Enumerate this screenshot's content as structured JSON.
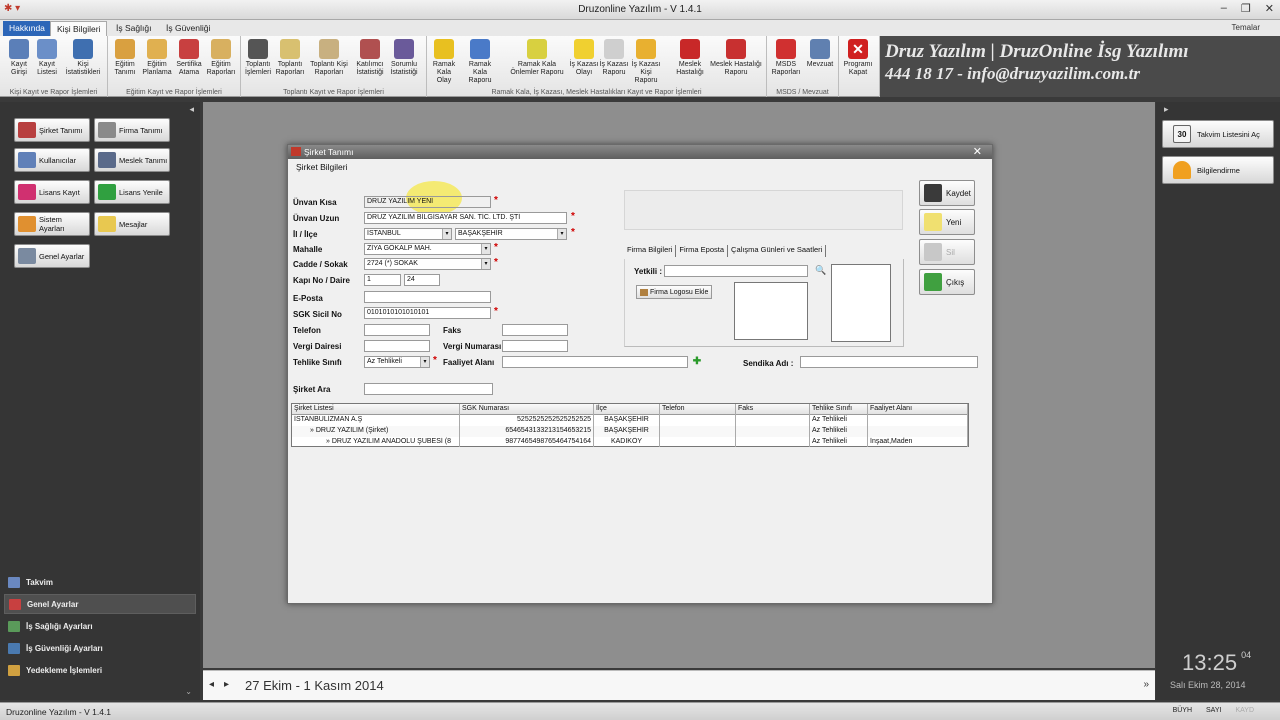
{
  "window": {
    "title": "Druzonline Yazılım - V 1.4.1"
  },
  "tabs": {
    "hakkinda": "Hakkında",
    "kisi": "Kişi Bilgileri",
    "saglik": "İş Sağlığı",
    "guvenlik": "İş Güvenliği",
    "temalar": "Temalar"
  },
  "ribbon": {
    "groups": [
      {
        "label": "Kişi Kayıt ve Rapor İşlemleri",
        "buttons": [
          "Kayıt Girişi",
          "Kayıt Listesi",
          "Kişi İstatistikleri"
        ]
      },
      {
        "label": "Eğitim Kayıt ve Rapor İşlemleri",
        "buttons": [
          "Eğitim Tanımı",
          "Eğitim Planlama",
          "Sertifika Atama",
          "Eğitim Raporları"
        ]
      },
      {
        "label": "Toplantı Kayıt ve Rapor İşlemleri",
        "buttons": [
          "Toplantı İşlemleri",
          "Toplantı Raporları",
          "Toplantı Kişi Raporları",
          "Katılımcı İstatistiği",
          "Sorumlu İstatistiği"
        ]
      },
      {
        "label": "Ramak Kala, İş Kazası, Meslek Hastalıkları Kayıt ve Rapor İşlemleri",
        "buttons": [
          "Ramak Kala Olay",
          "Ramak Kala Raporu",
          "Ramak Kala Önlemler Raporu",
          "İş Kazası Olayı",
          "İş Kazası Raporu",
          "İş Kazası Kişi Raporu",
          "Meslek Hastalığı",
          "Meslek Hastalığı Raporu"
        ]
      },
      {
        "label": "MSDS / Mevzuat",
        "buttons": [
          "MSDS Raporları",
          "Mevzuat"
        ]
      },
      {
        "label": "",
        "buttons": [
          "Programı Kapat"
        ]
      }
    ],
    "banner_line1": "Druz Yazılım | DruzOnline İsg Yazılımı",
    "banner_line2": "444 18 17  -  info@druzyazilim.com.tr"
  },
  "left_panel": {
    "buttons": [
      "Şirket Tanımı",
      "Firma Tanımı",
      "Kullanıcılar",
      "Meslek Tanımı",
      "Lisans Kayıt",
      "Lisans Yenile",
      "Sistem Ayarları",
      "Mesajlar",
      "Genel Ayarlar"
    ],
    "nav": [
      "Takvim",
      "Genel Ayarlar",
      "İş Sağlığı Ayarları",
      "İş Güvenliği Ayarları",
      "Yedekleme İşlemleri"
    ]
  },
  "right_panel": {
    "takvim": "Takvim Listesini Aç",
    "bilgi": "Bilgilendirme",
    "calendar_day": "30",
    "clock": "13:25",
    "seconds": "04",
    "date": "Salı Ekim 28, 2014"
  },
  "calendar_bar": {
    "range": "27 Ekim - 1 Kasım 2014"
  },
  "status_bar": {
    "version": "Druzonline Yazılım - V 1.4.1",
    "caps": [
      "BÜYH",
      "SAYI",
      "KAYD"
    ]
  },
  "dialog": {
    "title": "Şirket Tanımı",
    "menu": "Şirket Bilgileri",
    "labels": {
      "unvan_kisa": "Ünvan Kısa",
      "unvan_uzun": "Ünvan Uzun",
      "il_ilce": "İl / İlçe",
      "mahalle": "Mahalle",
      "cadde": "Cadde / Sokak",
      "kapi": "Kapı No / Daire",
      "eposta": "E-Posta",
      "sgk": "SGK Sicil No",
      "telefon": "Telefon",
      "faks": "Faks",
      "vergi_dairesi": "Vergi Dairesi",
      "vergi_no": "Vergi Numarası",
      "tehlike": "Tehlike Sınıfı",
      "faaliyet": "Faaliyet Alanı",
      "sendika": "Sendika Adı :",
      "sirket_ara": "Şirket Ara",
      "yetkili": "Yetkili :"
    },
    "values": {
      "unvan_kisa": "DRUZ YAZILIM YENİ",
      "unvan_uzun": "DRUZ YAZILIM BİLGİSAYAR SAN. TİC. LTD. ŞTİ",
      "il": "İSTANBUL",
      "ilce": "BAŞAKŞEHİR",
      "mahalle": "ZİYA GÖKALP MAH.",
      "cadde": "2724 (*) SOKAK",
      "kapi": "1",
      "daire": "24",
      "sgk": "0101010101010101",
      "tehlike": "Az Tehlikeli"
    },
    "subtabs": [
      "Firma Bilgileri",
      "Firma Eposta",
      "Çalışma Günleri ve Saatleri"
    ],
    "logo_button": "Firma Logosu Ekle",
    "buttons": {
      "kaydet": "Kaydet",
      "yeni": "Yeni",
      "sil": "Sil",
      "cikis": "Çıkış"
    },
    "grid": {
      "headers": [
        "Şirket Listesi",
        "SGK Numarası",
        "İlçe",
        "Telefon",
        "Faks",
        "Tehlike Sınıfı",
        "Faaliyet Alanı"
      ],
      "rows": [
        [
          "İSTANBULİZMAN A.Ş",
          "5252525252525252525",
          "BAŞAKŞEHİR",
          "",
          "",
          "Az Tehlikeli",
          ""
        ],
        [
          "» DRUZ YAZILIM  (Şirket)",
          "6546543133213154653215",
          "BAŞAKŞEHİR",
          "",
          "",
          "Az Tehlikeli",
          ""
        ],
        [
          "» DRUZ YAZILIM ANADOLU ŞUBESİ  (8",
          "9877465498765464754164",
          "KADIKÖY",
          "",
          "",
          "Az Tehlikeli",
          "İnşaat,Maden"
        ]
      ]
    }
  },
  "colors": {
    "accent": "#2c66b8",
    "required": "#d00000",
    "highlight": "#f5e84a"
  }
}
